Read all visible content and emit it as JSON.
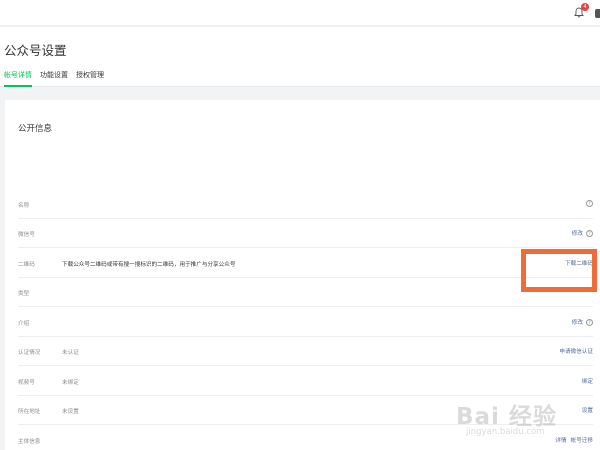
{
  "topbar": {
    "notification_count": "4",
    "icons": {
      "bell": "bell-icon",
      "avatar": "avatar"
    }
  },
  "header": {
    "title": "公众号设置",
    "tabs": [
      {
        "label": "帐号详情",
        "active": true
      },
      {
        "label": "功能设置",
        "active": false
      },
      {
        "label": "授权管理",
        "active": false
      }
    ]
  },
  "section": {
    "title": "公开信息",
    "rows": [
      {
        "label": "名称",
        "value": "",
        "actions": [],
        "help": true
      },
      {
        "label": "微信号",
        "value": "",
        "actions": [
          "修改"
        ],
        "help": true
      },
      {
        "label": "二维码",
        "value": "下载公众号二维码或带有搜一搜标识的二维码，用于推广与分享公众号",
        "actions": [
          "下载二维码"
        ],
        "help": false
      },
      {
        "label": "类型",
        "value": "",
        "actions": [],
        "help": false
      },
      {
        "label": "介绍",
        "value": "",
        "actions": [
          "修改"
        ],
        "help": true
      },
      {
        "label": "认证情况",
        "value": "未认证",
        "actions": [
          "申请微信认证"
        ],
        "help": false
      },
      {
        "label": "视频号",
        "value": "未绑定",
        "actions": [
          "绑定"
        ],
        "help": false
      },
      {
        "label": "所在地址",
        "value": "未设置",
        "actions": [
          "设置"
        ],
        "help": false
      },
      {
        "label": "主体信息",
        "value": "",
        "actions": [
          "详情",
          "帐号迁移"
        ],
        "help": false
      }
    ]
  },
  "colors": {
    "accent": "#07c160",
    "link": "#576b95",
    "highlight_box": "#ef6c3a",
    "badge": "#e64340"
  },
  "watermark": {
    "logo": "Bai 经验",
    "url": "jingyan.baidu.com"
  }
}
